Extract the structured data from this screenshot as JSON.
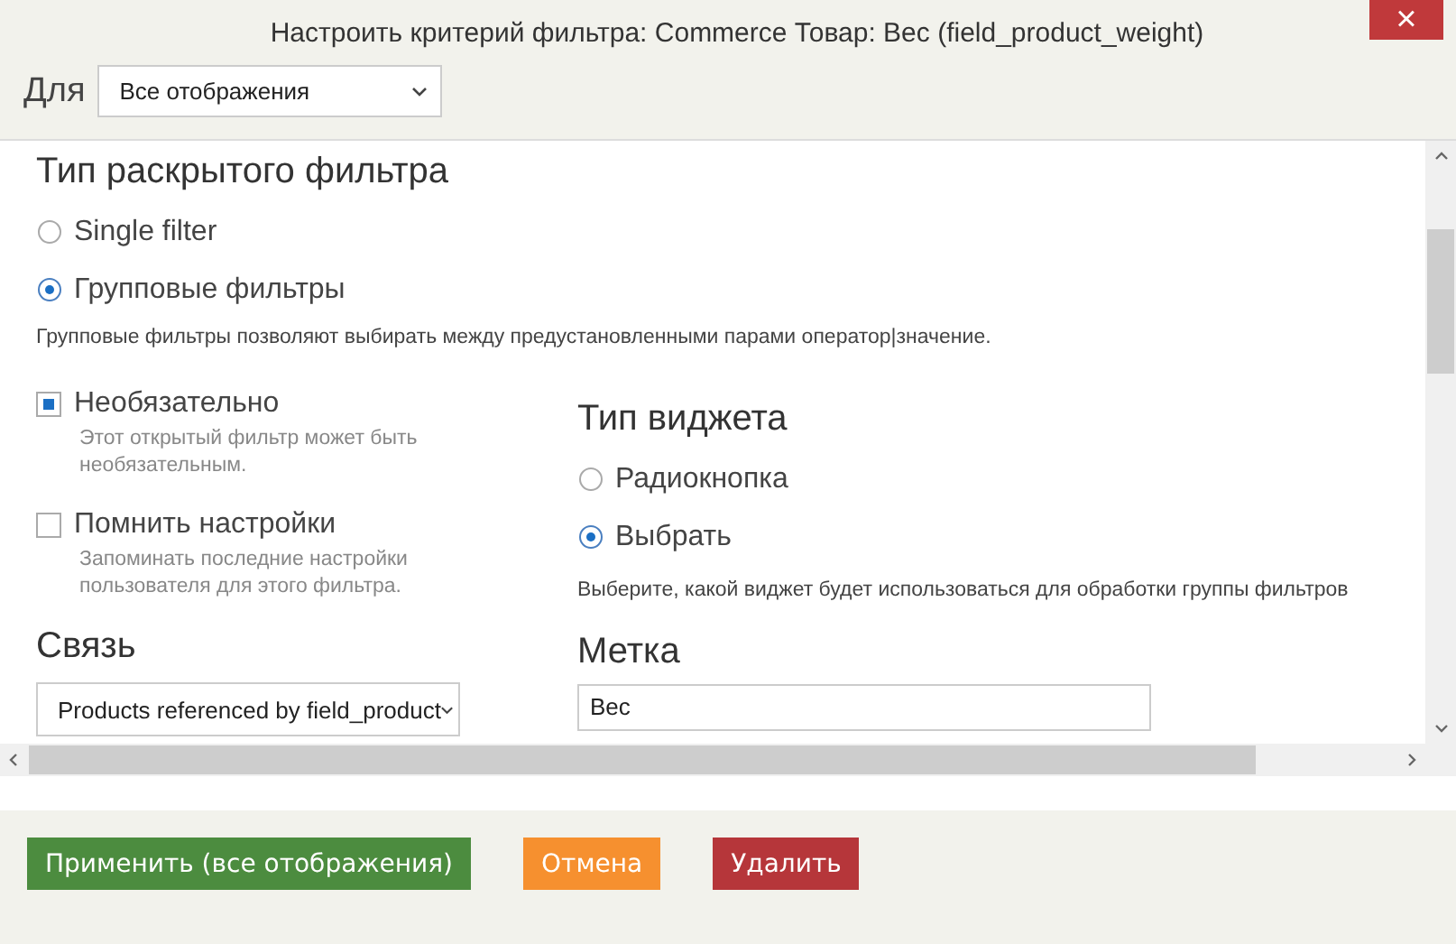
{
  "window": {
    "title": "Настроить критерий фильтра: Commerce Товар: Вес (field_product_weight)",
    "close": "×"
  },
  "for": {
    "label": "Для",
    "value": "Все отображения"
  },
  "filter_type": {
    "heading": "Тип раскрытого фильтра",
    "options": [
      {
        "label": "Single filter",
        "selected": false
      },
      {
        "label": "Групповые фильтры",
        "selected": true
      }
    ],
    "description": "Групповые фильтры позволяют выбирать между предустановленными парами оператор|значение."
  },
  "checkboxes": [
    {
      "label": "Необязательно",
      "checked": true,
      "description": "Этот открытый фильтр может быть необязательным."
    },
    {
      "label": "Помнить настройки",
      "checked": false,
      "description": "Запоминать последние настройки пользователя для этого фильтра."
    }
  ],
  "relationship": {
    "heading": "Связь",
    "value": "Products referenced by field_product"
  },
  "widget_type": {
    "heading": "Тип виджета",
    "options": [
      {
        "label": "Радиокнопка",
        "selected": false
      },
      {
        "label": "Выбрать",
        "selected": true
      }
    ],
    "description": "Выберите, какой виджет будет использоваться для обработки группы фильтров"
  },
  "label_field": {
    "heading": "Метка",
    "value": "Вес"
  },
  "buttons": [
    {
      "label": "Применить (все отображения)",
      "kind": "apply"
    },
    {
      "label": "Отмена",
      "kind": "cancel"
    },
    {
      "label": "Удалить",
      "kind": "delete"
    }
  ]
}
